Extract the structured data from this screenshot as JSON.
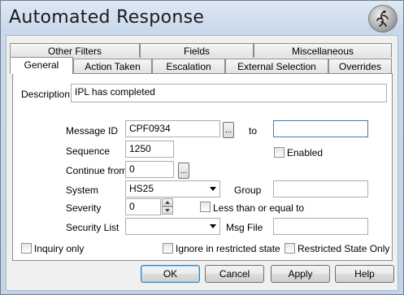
{
  "window": {
    "title": "Automated Response",
    "icon": "gecko-logo-icon"
  },
  "tabs": {
    "row1": [
      "Other Filters",
      "Fields",
      "Miscellaneous"
    ],
    "row2": [
      "General",
      "Action Taken",
      "Escalation",
      "External Selection",
      "Overrides"
    ],
    "active": "General"
  },
  "form": {
    "description_label": "Description",
    "description_value": "IPL has completed",
    "message_id_label": "Message ID",
    "message_id_value": "CPF0934",
    "message_id_browse": "...",
    "to_label": "to",
    "to_value": "",
    "sequence_label": "Sequence",
    "sequence_value": "1250",
    "enabled_label": "Enabled",
    "enabled_checked": false,
    "continue_from_label": "Continue from",
    "continue_from_value": "0",
    "continue_from_browse": "...",
    "system_label": "System",
    "system_value": "HS25",
    "group_label": "Group",
    "group_value": "",
    "severity_label": "Severity",
    "severity_value": "0",
    "less_than_label": "Less than or equal to",
    "less_than_checked": false,
    "security_list_label": "Security  List",
    "security_list_value": "",
    "msg_file_label": "Msg File",
    "msg_file_value": "",
    "inquiry_only_label": "Inquiry only",
    "inquiry_only_checked": false,
    "ignore_restricted_label": "Ignore in restricted state",
    "ignore_restricted_checked": false,
    "restricted_only_label": "Restricted State Only",
    "restricted_only_checked": false
  },
  "buttons": {
    "ok": "OK",
    "cancel": "Cancel",
    "apply": "Apply",
    "help": "Help"
  }
}
